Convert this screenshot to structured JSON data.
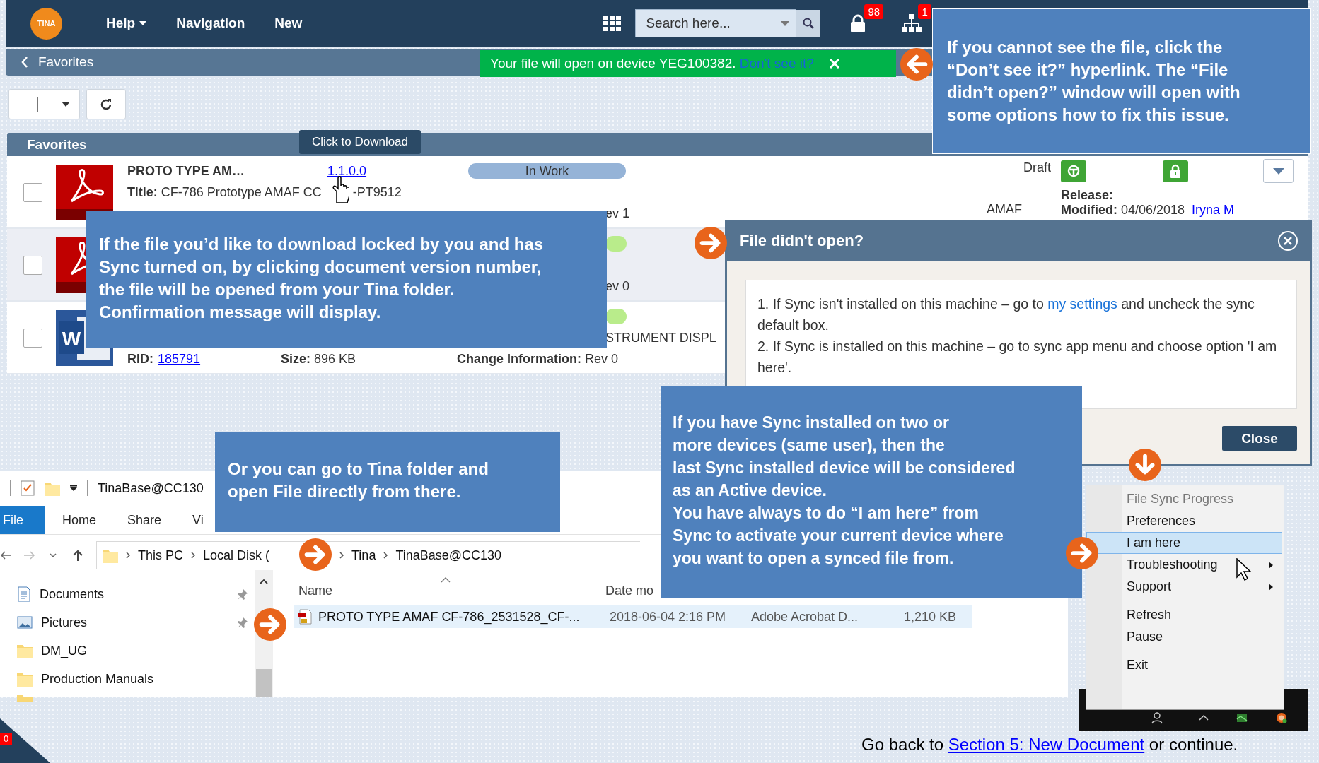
{
  "topbar": {
    "logo": "TINA",
    "menu": [
      {
        "label": "Help",
        "dropdown": true
      },
      {
        "label": "Navigation",
        "dropdown": false
      },
      {
        "label": "New",
        "dropdown": false
      }
    ],
    "search": {
      "placeholder": "Search here..."
    },
    "notifications": [
      {
        "kind": "lock",
        "badge": "98"
      },
      {
        "kind": "network",
        "badge": "1"
      }
    ]
  },
  "breadcrumb": {
    "label": "Favorites"
  },
  "toast": {
    "message": "Your file will open on device YEG100382. ",
    "link": "Don't see it?"
  },
  "toolbar": {
    "select_all": {
      "checked": false
    }
  },
  "list": {
    "title": "Favorites",
    "tooltip": "Click to Download",
    "rows": [
      {
        "kind": "pdf",
        "checked": false,
        "name": "PROTO TYPE AM…",
        "version": "1.1.0.0",
        "title": "**Title:** CF-786 Prototype AMAF CC",
        "title_tail": "-PT9512",
        "status": "In Work",
        "color": "#95b3d7",
        "revision": "ev 1",
        "state": "Draft",
        "owner": "AMAF",
        "sync": true,
        "locked": true,
        "release": "Release:",
        "modified": "**Modified:** 04/06/2018",
        "modified_by": "Iryna M"
      },
      {
        "kind": "pdf",
        "checked": false,
        "color": "#b9ec8b",
        "revision": "ev 0"
      },
      {
        "kind": "word",
        "icon_label": "W",
        "checked": false,
        "color": "#b9ec8b",
        "description": "STRUMENT DISPL",
        "rid_label": "RID:",
        "rid": "185791",
        "size": "**Size:** 896 KB",
        "change_info": "**Change Information:** Rev 0"
      }
    ]
  },
  "dialog": {
    "title": "File didn't open?",
    "steps": [
      {
        "before": "1. If Sync isn't installed on this machine – go to ",
        "link": "my settings",
        "after": " and uncheck the sync default box."
      },
      {
        "before": "2. If Sync is installed on this machine – go to sync app menu and choose option 'I am here'."
      }
    ],
    "button": "Close"
  },
  "explorer": {
    "title": "TinaBase@CC130",
    "ribbon": [
      {
        "label": "File",
        "kind": "menu"
      },
      {
        "label": "Home",
        "kind": "tab"
      },
      {
        "label": "Share",
        "kind": "tab"
      },
      {
        "label": "Vi",
        "kind": "tab"
      }
    ],
    "path": [
      "This PC",
      "Local Disk (",
      "Tina",
      "TinaBase@CC130"
    ],
    "nav": [
      {
        "label": "Documents",
        "kind": "documents",
        "pinned": true
      },
      {
        "label": "Pictures",
        "kind": "pictures",
        "pinned": true
      },
      {
        "label": "DM_UG",
        "kind": "folder",
        "pinned": false
      },
      {
        "label": "Production Manuals",
        "kind": "folder",
        "pinned": false
      }
    ],
    "columns": [
      "Name",
      "Date mo"
    ],
    "files": [
      {
        "name": "PROTO TYPE AMAF CF-786_2531528_CF-...",
        "date": "2018-06-04 2:16 PM",
        "type": "Adobe Acrobat D...",
        "size": "1,210 KB",
        "selected": true
      }
    ]
  },
  "tray_menu": {
    "groups": [
      [
        {
          "label": "File Sync Progress",
          "disabled": true,
          "selected": false,
          "submenu": false
        },
        {
          "label": "Preferences",
          "disabled": false,
          "selected": false,
          "submenu": false
        },
        {
          "label": "I am here",
          "disabled": false,
          "selected": true,
          "submenu": false
        },
        {
          "label": "Troubleshooting",
          "disabled": false,
          "selected": false,
          "submenu": true
        },
        {
          "label": "Support",
          "disabled": false,
          "selected": false,
          "submenu": true
        }
      ],
      [
        {
          "label": "Refresh",
          "disabled": false,
          "selected": false,
          "submenu": false
        },
        {
          "label": "Pause",
          "disabled": false,
          "selected": false,
          "submenu": false
        }
      ],
      [
        {
          "label": "Exit",
          "disabled": false,
          "selected": false,
          "submenu": false
        }
      ]
    ]
  },
  "callouts": [
    {
      "lines": [
        "If you cannot see the file, click the",
        "“Don’t see it?” hyperlink. The “File",
        "didn’t open?” window  will open with",
        "some options how to fix this issue."
      ]
    },
    {
      "lines": [
        "If the file you’d like to download locked by you and has",
        "Sync turned on, by clicking document version number,",
        "the file will be opened from your Tina folder.",
        "Confirmation message will display."
      ]
    },
    {
      "lines": [
        "Or you can go to Tina folder and",
        "open File directly from there."
      ]
    },
    {
      "lines": [
        "If you have Sync installed on two or",
        "more devices (same user), then the",
        "last Sync installed device will be considered",
        "as an Active device.",
        "You have always to do “I am here” from",
        "Sync to activate your current device where",
        "you want to open a synced file from."
      ]
    }
  ],
  "corner_badge": "0",
  "footer": {
    "before": "Go back to ",
    "link": "Section 5: New Document",
    "after": " or continue."
  }
}
